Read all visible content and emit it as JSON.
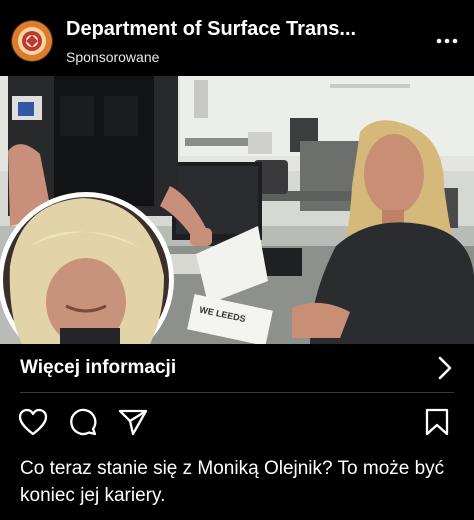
{
  "post": {
    "account_name": "Department of Surface Trans...",
    "sponsored_label": "Sponsorowane",
    "more_icon": "more-horizontal-icon",
    "cta_label": "Więcej informacji",
    "cta_icon": "chevron-right-icon",
    "actions": [
      "heart-icon",
      "comment-icon",
      "share-icon",
      "bookmark-icon"
    ],
    "caption": "Co teraz stanie się z Moniką Olejnik? To może być koniec jej kariery.",
    "media_text": "WE LEEDS"
  },
  "colors": {
    "background": "#000000",
    "text": "#ffffff",
    "avatar": "#e07b2a"
  }
}
